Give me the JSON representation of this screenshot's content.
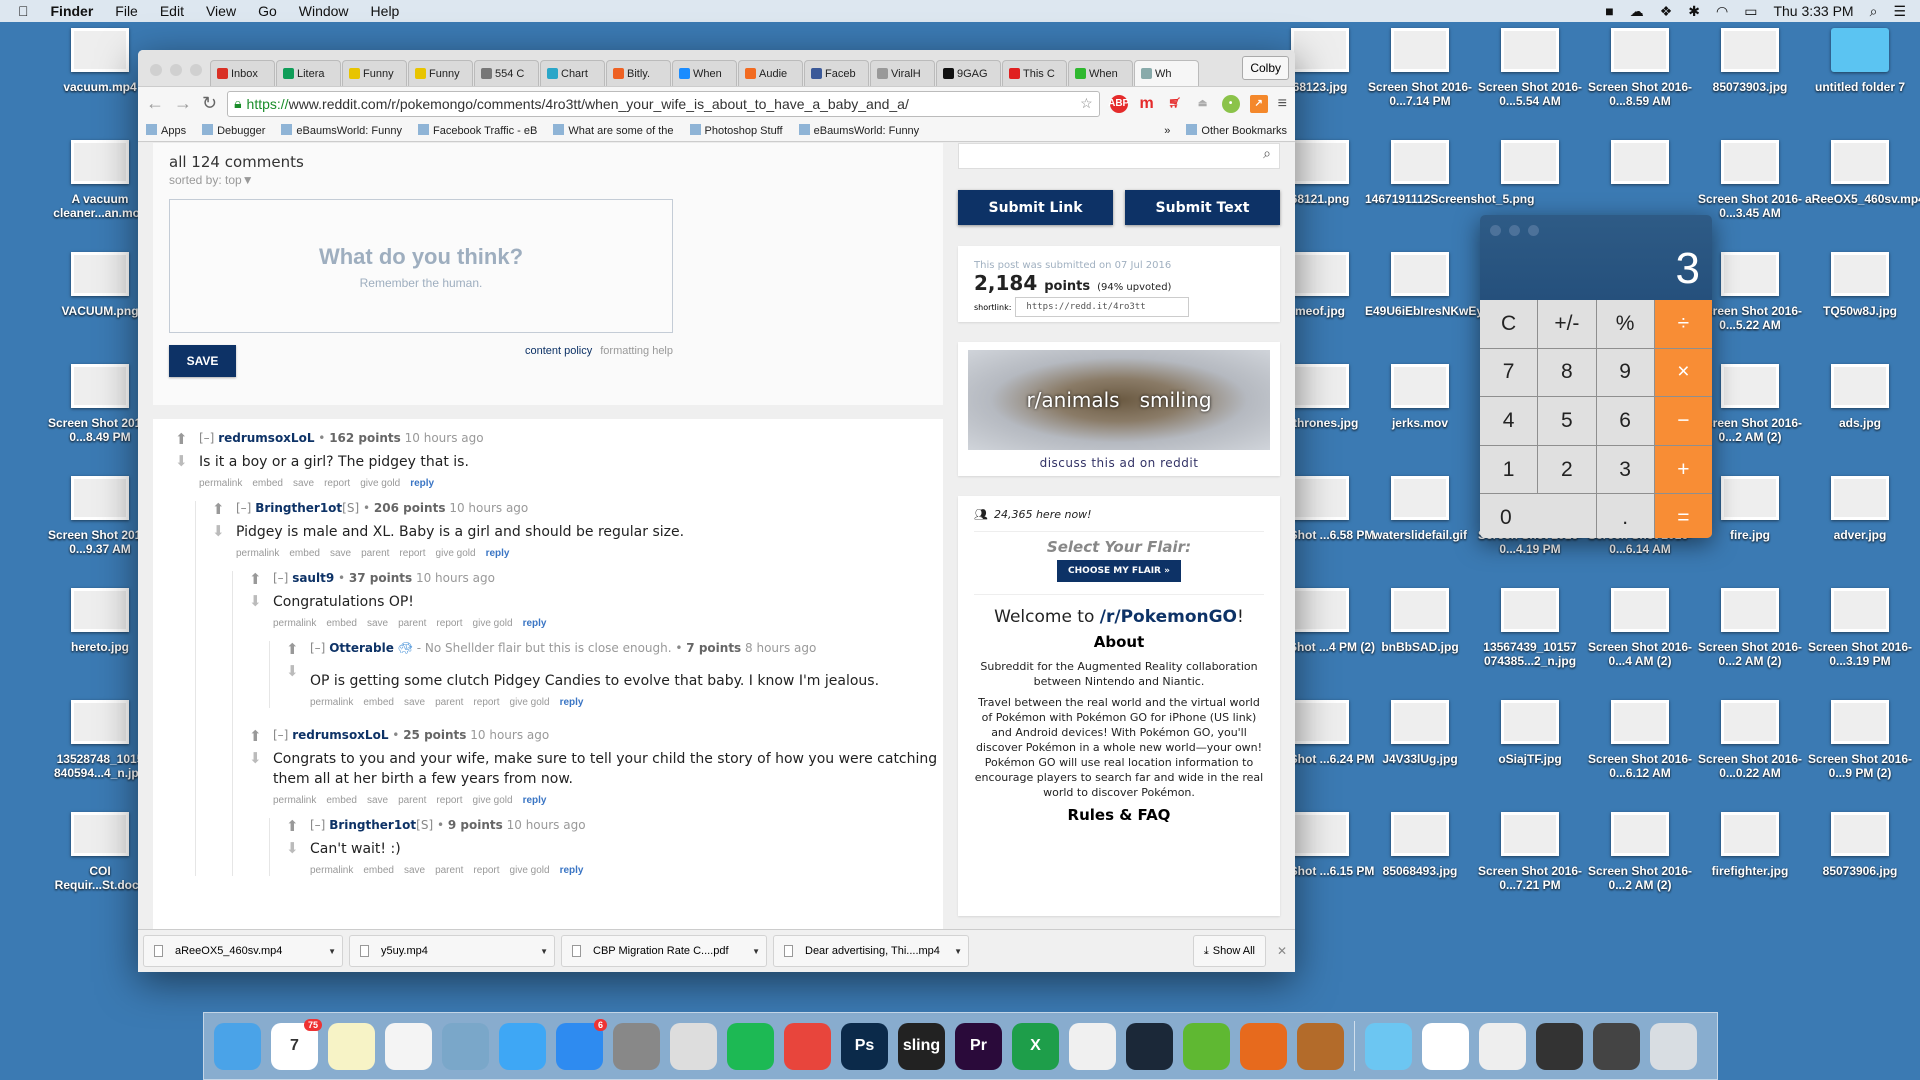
{
  "menubar": {
    "items": [
      "Finder",
      "File",
      "Edit",
      "View",
      "Go",
      "Window",
      "Help"
    ],
    "clock": "Thu 3:33 PM"
  },
  "desktop": {
    "left": [
      "vacuum.mp4",
      "A vacuum cleaner...an.mov",
      "VACUUM.png",
      "Screen Shot 2016-0...8.49 PM",
      "Screen Shot 2016-0...9.37 AM",
      "hereto.jpg",
      "13528748_1015 840594...4_n.jpg",
      "COI Requir...St.docx"
    ],
    "columns": [
      [
        "68123.jpg",
        "68121.png",
        "meof.jpg",
        "ofthrones.jpg",
        "een Shot ...6.58 PM",
        "een Shot ...4 PM (2)",
        "een Shot ...6.24 PM",
        "een Shot ...6.15 PM"
      ],
      [
        "Screen Shot 2016-0...7.14 PM",
        "1467191112Screenshot_5.png",
        "E49U6iEbIresNKwEy_z...NSE.jpg",
        "jerks.mov",
        "waterslidefail.gif",
        "bnBbSAD.jpg",
        "J4V33lUg.jpg",
        "85068493.jpg"
      ],
      [
        "Screen Shot 2016-0...5.54 AM",
        "",
        "",
        "",
        "Screen Shot 2016-0...4.19 PM",
        "13567439_10157 074385...2_n.jpg",
        "oSiajTF.jpg",
        "Screen Shot 2016-0...7.21 PM"
      ],
      [
        "Screen Shot 2016-0...8.59 AM",
        "",
        "",
        "",
        "Screen Shot 2016-0...6.14 AM",
        "Screen Shot 2016-0...4 AM (2)",
        "Screen Shot 2016-0...6.12 AM",
        "Screen Shot 2016-0...2 AM (2)"
      ],
      [
        "85073903.jpg",
        "Screen Shot 2016-0...3.45 AM",
        "Screen Shot 2016-0...5.22 AM",
        "Screen Shot 2016-0...2 AM (2)",
        "fire.jpg",
        "Screen Shot 2016-0...2 AM (2)",
        "Screen Shot 2016-0...0.22 AM",
        "firefighter.jpg"
      ],
      [
        "untitled folder 7",
        "aReeOX5_460sv.mp4",
        "TQ50w8J.jpg",
        "ads.jpg",
        "adver.jpg",
        "Screen Shot 2016-0...3.19 PM",
        "Screen Shot 2016-0...9 PM (2)",
        "85073906.jpg"
      ]
    ]
  },
  "browser": {
    "tabs": [
      {
        "label": "Inbox",
        "color": "#d93025"
      },
      {
        "label": "Litera",
        "color": "#0f9d58"
      },
      {
        "label": "Funny",
        "color": "#e8c400"
      },
      {
        "label": "Funny",
        "color": "#e8c400"
      },
      {
        "label": "554 C",
        "color": "#777"
      },
      {
        "label": "Chart",
        "color": "#2aa6c8"
      },
      {
        "label": "Bitly.",
        "color": "#ee6123"
      },
      {
        "label": "When",
        "color": "#1a8cff"
      },
      {
        "label": "Audie",
        "color": "#f26b21"
      },
      {
        "label": "Faceb",
        "color": "#3b5998"
      },
      {
        "label": "ViralH",
        "color": "#999"
      },
      {
        "label": "9GAG",
        "color": "#111"
      },
      {
        "label": "This C",
        "color": "#e02020"
      },
      {
        "label": "When",
        "color": "#2fb82f"
      },
      {
        "label": "Wh",
        "color": "#8aa"
      }
    ],
    "profile": "Colby",
    "url_scheme": "https://",
    "url_rest": "www.reddit.com/r/pokemongo/comments/4ro3tt/when_your_wife_is_about_to_have_a_baby_and_a/",
    "bookmarks": [
      "Apps",
      "Debugger",
      "eBaumsWorld: Funny",
      "Facebook Traffic - eB",
      "What are some of the",
      "Photoshop Stuff",
      "eBaumsWorld: Funny"
    ],
    "other_bookmarks": "Other Bookmarks",
    "downloads": [
      "aReeOX5_460sv.mp4",
      "y5uy.mp4",
      "CBP Migration Rate C....pdf",
      "Dear advertising, Thi....mp4"
    ],
    "show_all": "Show All"
  },
  "page": {
    "comments_title": "all 124 comments",
    "sorted": "sorted by: top▼",
    "placeholder_q": "What do you think?",
    "placeholder_s": "Remember the human.",
    "save": "SAVE",
    "content_policy": "content policy",
    "formatting_help": "formatting help",
    "comments": [
      {
        "author": "redrumsoxLoL",
        "points": "162 points",
        "time": "10 hours ago",
        "body": "Is it a boy or a girl? The pidgey that is.",
        "actions": [
          "permalink",
          "embed",
          "save",
          "report",
          "give gold",
          "reply"
        ]
      },
      {
        "author": "Bringther1ot",
        "op": "[S]",
        "points": "206 points",
        "time": "10 hours ago",
        "body": "Pidgey is male and XL. Baby is a girl and should be regular size.",
        "actions": [
          "permalink",
          "embed",
          "save",
          "parent",
          "report",
          "give gold",
          "reply"
        ]
      },
      {
        "author": "sault9",
        "points": "37 points",
        "time": "10 hours ago",
        "body": "Congratulations OP!",
        "actions": [
          "permalink",
          "embed",
          "save",
          "parent",
          "report",
          "give gold",
          "reply"
        ]
      },
      {
        "author": "Otterable",
        "flair": "- No Shellder flair but this is close enough.",
        "points": "7 points",
        "time": "8 hours ago",
        "body": "OP is getting some clutch Pidgey Candies to evolve that baby. I know I'm jealous.",
        "actions": [
          "permalink",
          "embed",
          "save",
          "parent",
          "report",
          "give gold",
          "reply"
        ]
      },
      {
        "author": "redrumsoxLoL",
        "points": "25 points",
        "time": "10 hours ago",
        "body": "Congrats to you and your wife, make sure to tell your child the story of how you were catching them all at her birth a few years from now.",
        "actions": [
          "permalink",
          "embed",
          "save",
          "parent",
          "report",
          "give gold",
          "reply"
        ]
      },
      {
        "author": "Bringther1ot",
        "op": "[S]",
        "points": "9 points",
        "time": "10 hours ago",
        "body": "Can't wait! :)",
        "actions": [
          "permalink",
          "embed",
          "save",
          "parent",
          "report",
          "give gold",
          "reply"
        ]
      }
    ],
    "sidebar": {
      "submit_link": "Submit Link",
      "submit_text": "Submit Text",
      "submitted": "This post was submitted on 07 Jul 2016",
      "points": "2,184",
      "points_label": "points",
      "upvoted": "(94% upvoted)",
      "shortlink_label": "shortlink:",
      "shortlink": "https://redd.it/4ro3tt",
      "ad_text_1": "r/animals",
      "ad_text_2": "smiling",
      "ad_discuss": "discuss this ad on reddit",
      "here_now": "24,365 here now!",
      "select_flair": "Select Your Flair:",
      "flair_btn": "CHOOSE MY FLAIR »",
      "welcome": "Welcome to ",
      "sub": "/r/PokemonGO",
      "excl": "!",
      "about": "About",
      "about_p1": "Subreddit for the Augmented Reality collaboration between Nintendo and Niantic.",
      "about_p2": "Travel between the real world and the virtual world of Pokémon with Pokémon GO for iPhone (US link) and Android devices! With Pokémon GO, you'll discover Pokémon in a whole new world—your own! Pokémon GO will use real location information to encourage players to search far and wide in the real world to discover Pokémon.",
      "rules": "Rules & FAQ"
    }
  },
  "calculator": {
    "display": "3",
    "keys": [
      "C",
      "+/-",
      "%",
      "÷",
      "7",
      "8",
      "9",
      "×",
      "4",
      "5",
      "6",
      "−",
      "1",
      "2",
      "3",
      "+",
      "0",
      ".",
      "="
    ]
  },
  "dock": [
    {
      "name": "finder",
      "color": "#4aa3e8"
    },
    {
      "name": "calendar",
      "color": "#fff",
      "label": "7",
      "badge": "75"
    },
    {
      "name": "notes",
      "color": "#f7f3c6"
    },
    {
      "name": "photos",
      "color": "#f4f4f4"
    },
    {
      "name": "preview",
      "color": "#7aa7c9"
    },
    {
      "name": "messages",
      "color": "#3ea7f5"
    },
    {
      "name": "app-store",
      "color": "#2e8bf0",
      "badge": "6"
    },
    {
      "name": "system-preferences",
      "color": "#888"
    },
    {
      "name": "scrivener",
      "color": "#ddd"
    },
    {
      "name": "spotify",
      "color": "#1db954"
    },
    {
      "name": "chrome",
      "color": "#e8453c"
    },
    {
      "name": "photoshop",
      "color": "#0b2a4a",
      "label": "Ps"
    },
    {
      "name": "sling",
      "color": "#222",
      "label": "sling"
    },
    {
      "name": "premiere",
      "color": "#2a0a3a",
      "label": "Pr"
    },
    {
      "name": "excel",
      "color": "#1e9e4a",
      "label": "X"
    },
    {
      "name": "itunes",
      "color": "#f0f0f0"
    },
    {
      "name": "steam",
      "color": "#1b2838"
    },
    {
      "name": "utorrent",
      "color": "#5fb832"
    },
    {
      "name": "firefox",
      "color": "#e76a1d"
    },
    {
      "name": "calculator",
      "color": "#b36b2a"
    },
    {
      "name": "folder",
      "color": "#6cc6f2"
    },
    {
      "name": "document",
      "color": "#fff"
    },
    {
      "name": "recent-1",
      "color": "#eee"
    },
    {
      "name": "recent-2",
      "color": "#333"
    },
    {
      "name": "recent-3",
      "color": "#444"
    },
    {
      "name": "trash",
      "color": "#d8dde2"
    }
  ]
}
